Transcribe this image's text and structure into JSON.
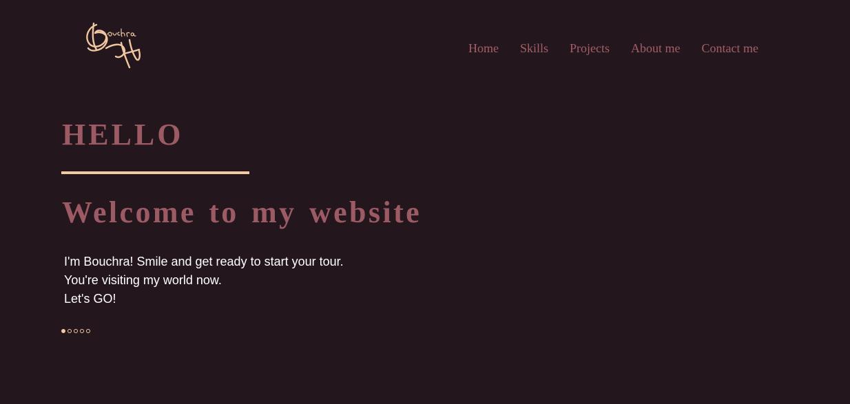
{
  "header": {
    "logo_text": "Bouchra BH",
    "nav": [
      {
        "label": "Home"
      },
      {
        "label": "Skills"
      },
      {
        "label": "Projects"
      },
      {
        "label": "About me"
      },
      {
        "label": "Contact me"
      }
    ]
  },
  "hero": {
    "greeting": "HELLO",
    "headline": "Welcome to my website",
    "intro_lines": [
      "I'm Bouchra! Smile and get ready to start your tour.",
      "You're visiting my world now.",
      "Let's GO!"
    ]
  },
  "slider": {
    "total_slides": 5,
    "active_slide": 1
  },
  "colors": {
    "background": "#23161d",
    "accent_rose": "#9c5a64",
    "accent_peach": "#f3c9a4",
    "text": "#ffffff"
  }
}
